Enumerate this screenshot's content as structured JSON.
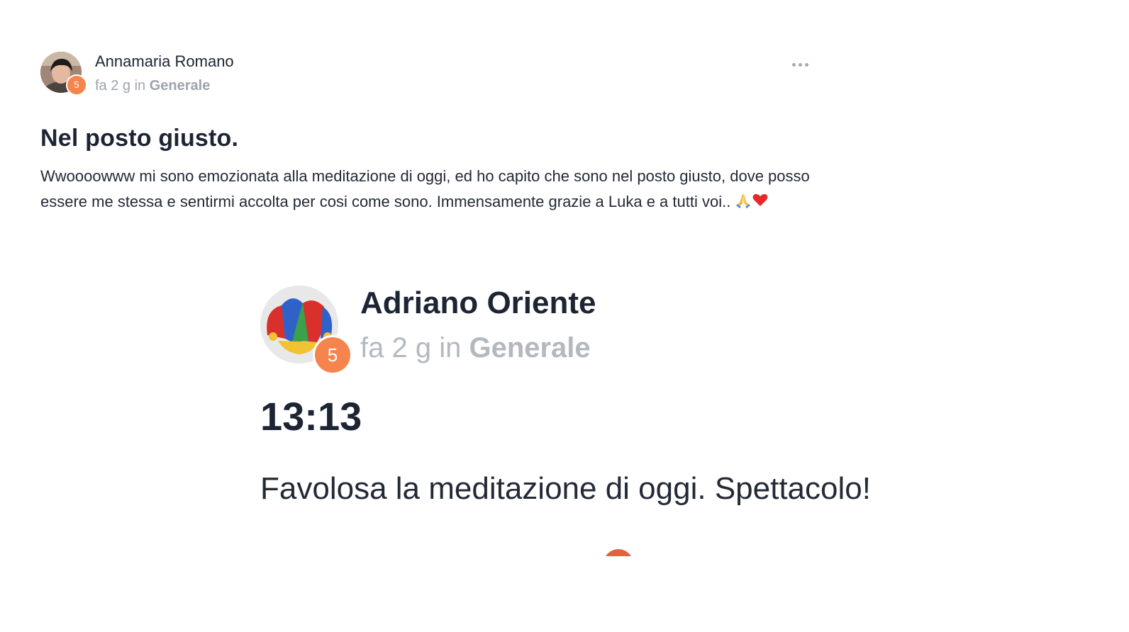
{
  "post": {
    "author": "Annamaria Romano",
    "level": "5",
    "meta_time": "fa 2 g in",
    "meta_space": "Generale",
    "title": "Nel posto giusto.",
    "body": "Wwoooowww mi sono emozionata alla meditazione di oggi, ed ho capito che sono nel posto giusto, dove posso essere me stessa e sentirmi accolta per cosi come sono. Immensamente grazie a Luka e a tutti voi.. ",
    "emojis": [
      "praying-hands-icon",
      "red-heart-icon"
    ]
  },
  "embed": {
    "author": "Adriano Oriente",
    "level": "5",
    "meta_time": "fa 2 g in",
    "meta_space": "Generale",
    "title": "13:13",
    "body": "Favolosa la meditazione di oggi. Spettacolo!"
  },
  "colors": {
    "badge": "#f5854c",
    "title_text": "#1d2433",
    "meta_text": "#9ea3ad"
  }
}
